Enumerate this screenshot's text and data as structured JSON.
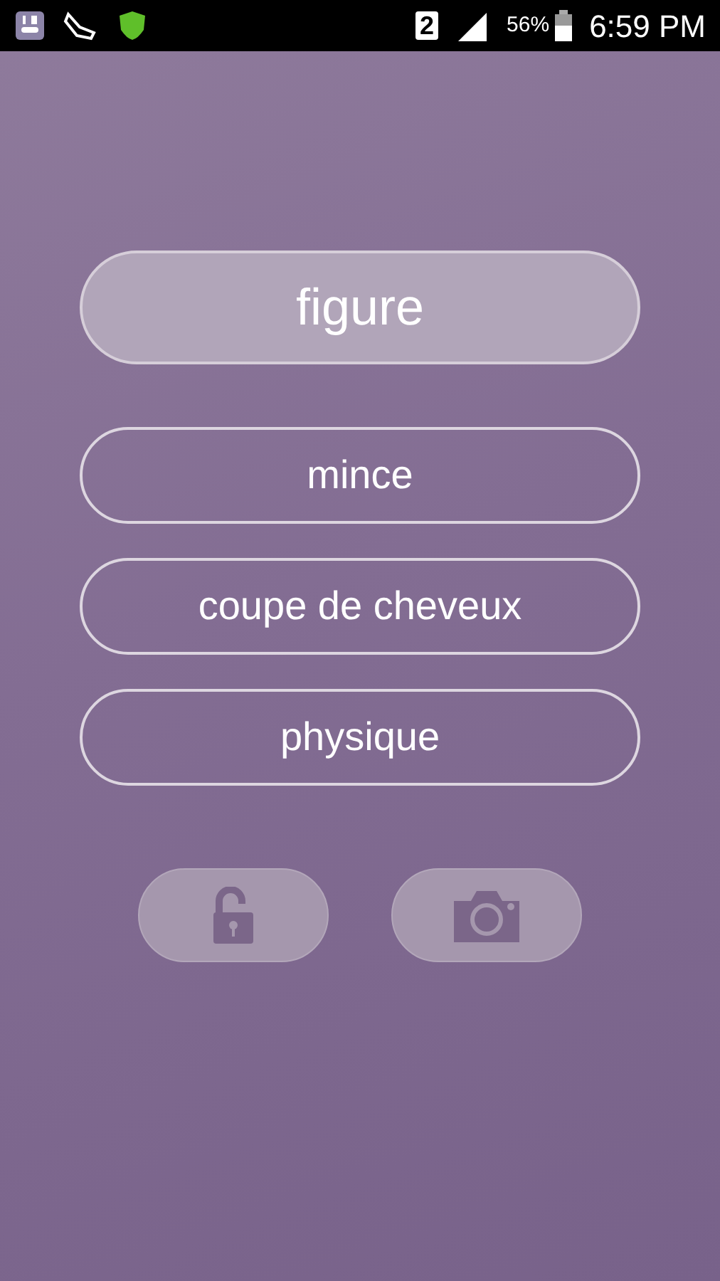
{
  "status_bar": {
    "sim_slot": "2",
    "battery": "56%",
    "time": "6:59 PM"
  },
  "word": "figure",
  "choices": [
    {
      "label": "mince"
    },
    {
      "label": "coupe de cheveux"
    },
    {
      "label": "physique"
    }
  ]
}
